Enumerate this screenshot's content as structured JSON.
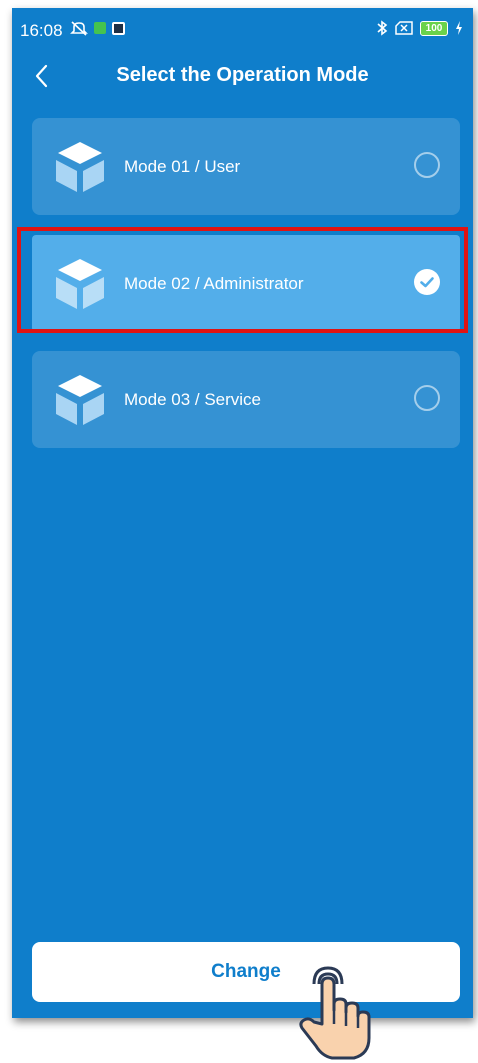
{
  "status_bar": {
    "time": "16:08",
    "battery": "100"
  },
  "header": {
    "title": "Select the Operation Mode"
  },
  "modes": [
    {
      "label": "Mode 01 / User",
      "selected": false
    },
    {
      "label": "Mode 02 / Administrator",
      "selected": true
    },
    {
      "label": "Mode 03 / Service",
      "selected": false
    }
  ],
  "actions": {
    "change_label": "Change"
  },
  "colors": {
    "background": "#0f7ecb",
    "selected_card": "#53aeea",
    "highlight": "#e01313",
    "button_text": "#0f7ecb"
  }
}
